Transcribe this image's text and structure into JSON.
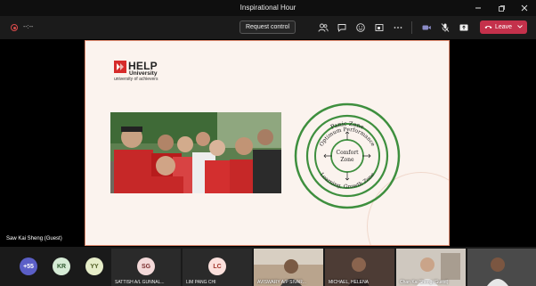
{
  "window": {
    "title": "Inspirational Hour"
  },
  "toolbar": {
    "timer": "--:--",
    "request_control": "Request control",
    "leave_label": "Leave"
  },
  "slide": {
    "logo_word": "HELP",
    "logo_sub1": "University",
    "logo_sub2": "university of achievers",
    "zones": {
      "outer": "Panic Zone",
      "middle": "Optimum Performance",
      "inner_1": "Comfort",
      "inner_2": "Zone",
      "bottom": "Learning, Growth Zone"
    }
  },
  "stage": {
    "speaker": "Saw Kai Sheng (Guest)"
  },
  "gallery": {
    "more": "+55",
    "avatars": [
      {
        "initials": "KR",
        "color": "#d6ecd6",
        "text_color": "#2f5b2f"
      },
      {
        "initials": "YY",
        "color": "#e6edc8",
        "text_color": "#4d5a20"
      }
    ],
    "tiles": [
      {
        "initials": "SG",
        "name": "SATTISH A/L GUNNAL...",
        "color": "#f3d9d9",
        "text_color": "#7a2e2e"
      },
      {
        "initials": "LC",
        "name": "LIM PANG CHI",
        "color": "#fbe0dc",
        "text_color": "#a0362b"
      }
    ],
    "videos": [
      {
        "name": "AVISWARY A/P SIVAR..."
      },
      {
        "name": "MICHAEL, HELENA"
      },
      {
        "name": "Chan Kai Sheng (Guest)"
      },
      {
        "name": ""
      }
    ]
  },
  "colors": {
    "leave": "#c4314b",
    "accent": "#6264a7",
    "slide_border": "#e08a6f",
    "zone_green": "#3e8f3e"
  }
}
